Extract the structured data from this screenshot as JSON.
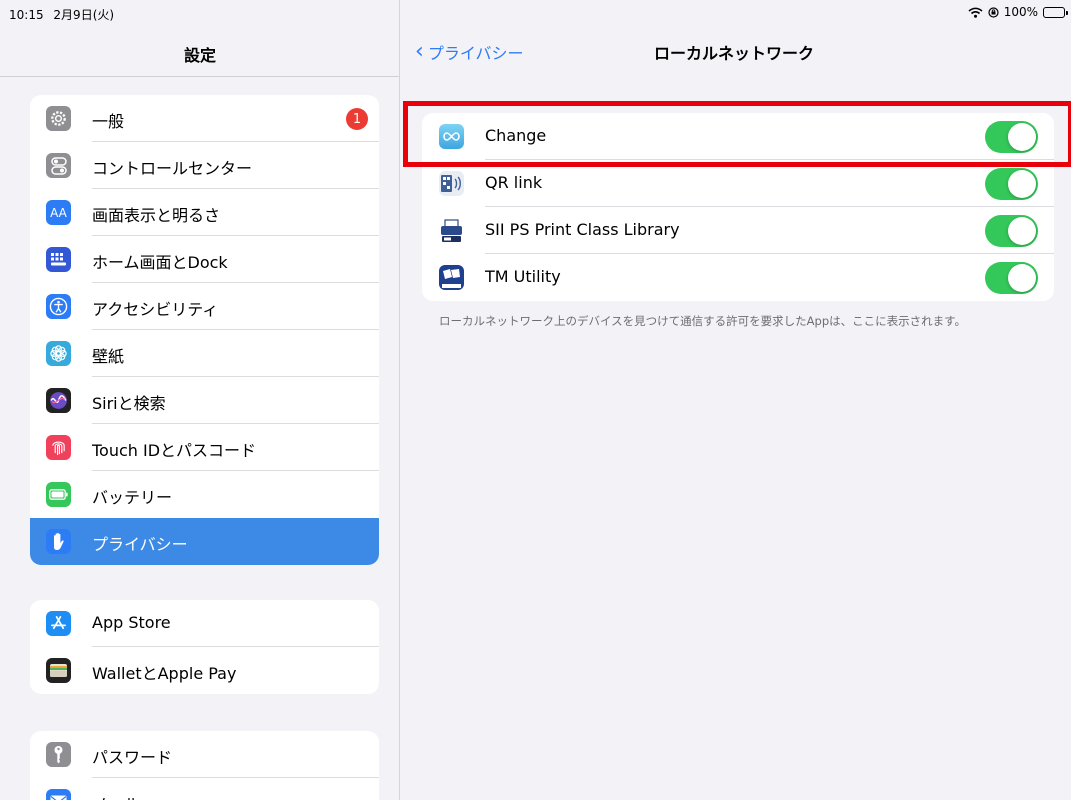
{
  "status": {
    "time": "10:15",
    "date": "2月9日(火)",
    "battery": "100%"
  },
  "sidebar": {
    "title": "設定",
    "group1": [
      {
        "label": "一般",
        "icon": "gear-icon",
        "color": "#8e8e93",
        "badge": "1"
      },
      {
        "label": "コントロールセンター",
        "icon": "toggles-icon",
        "color": "#8e8e93"
      },
      {
        "label": "画面表示と明るさ",
        "icon": "text-size-icon",
        "color": "#2c7cf6"
      },
      {
        "label": "ホーム画面とDock",
        "icon": "home-grid-icon",
        "color": "#3358d6"
      },
      {
        "label": "アクセシビリティ",
        "icon": "accessibility-icon",
        "color": "#2c7cf6"
      },
      {
        "label": "壁紙",
        "icon": "wallpaper-flower-icon",
        "color": "#36aadc"
      },
      {
        "label": "Siriと検索",
        "icon": "siri-icon",
        "color": "#222222"
      },
      {
        "label": "Touch IDとパスコード",
        "icon": "fingerprint-icon",
        "color": "#f0405c"
      },
      {
        "label": "バッテリー",
        "icon": "battery-icon",
        "color": "#35c759"
      },
      {
        "label": "プライバシー",
        "icon": "hand-icon",
        "color": "#2c7cf6",
        "selected": true
      }
    ],
    "group2": [
      {
        "label": "App Store",
        "icon": "app-store-icon",
        "color": "#1e8ef5"
      },
      {
        "label": "WalletとApple Pay",
        "icon": "wallet-icon",
        "color": "#222222"
      }
    ],
    "group3": [
      {
        "label": "パスワード",
        "icon": "key-icon",
        "color": "#8e8e93"
      },
      {
        "label": "メール",
        "icon": "mail-icon",
        "color": "#2c7cf6"
      }
    ]
  },
  "detail": {
    "back_label": "プライバシー",
    "title": "ローカルネットワーク",
    "apps": [
      {
        "name": "Change",
        "icon": "change-app-icon",
        "color": "#47b4ea",
        "enabled": true
      },
      {
        "name": "QR link",
        "icon": "qr-link-app-icon",
        "color": "#5a7fb8",
        "enabled": true
      },
      {
        "name": "SII PS Print Class Library",
        "icon": "sii-printer-app-icon",
        "color": "#2a4a8c",
        "enabled": true
      },
      {
        "name": "TM Utility",
        "icon": "tm-utility-app-icon",
        "color": "#1f3f8f",
        "enabled": true
      }
    ],
    "footnote": "ローカルネットワーク上のデバイスを見つけて通信する許可を要求したAppは、ここに表示されます。",
    "toggle_on_color": "#34c759",
    "highlight_color": "#e8000b"
  }
}
